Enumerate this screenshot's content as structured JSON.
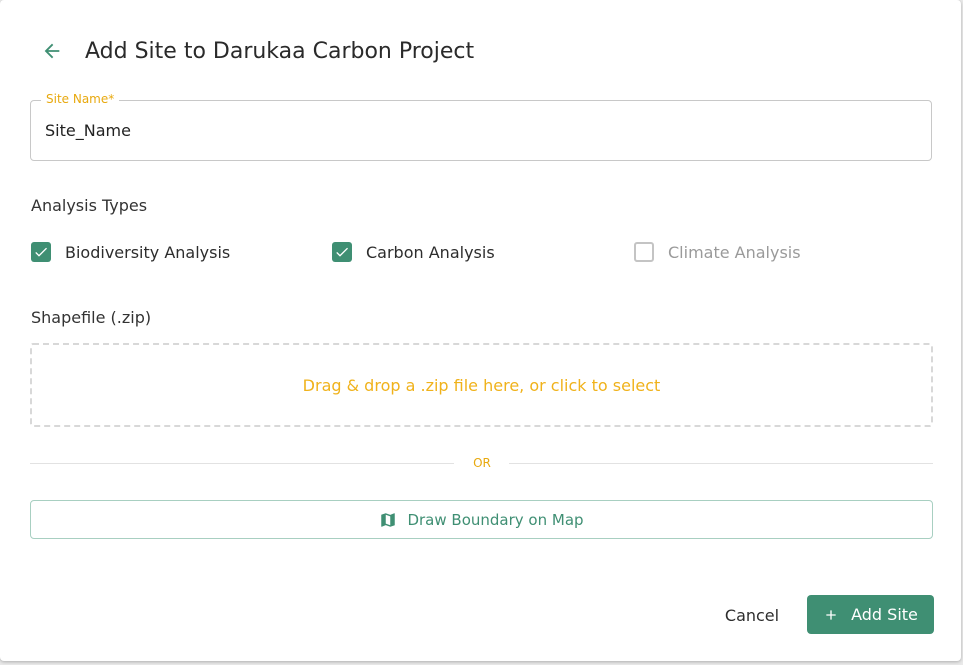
{
  "colors": {
    "accent_green": "#3f8f73",
    "label_amber": "#e8a90f",
    "dropzone_text": "#f0b21b"
  },
  "header": {
    "back_icon": "arrow-left-icon",
    "title": "Add Site to Darukaa Carbon Project"
  },
  "site_name": {
    "label": "Site Name",
    "required_mark": "*",
    "value": "Site_Name"
  },
  "analysis": {
    "heading": "Analysis Types",
    "options": [
      {
        "label": "Biodiversity Analysis",
        "checked": true,
        "disabled": false
      },
      {
        "label": "Carbon Analysis",
        "checked": true,
        "disabled": false
      },
      {
        "label": "Climate Analysis",
        "checked": false,
        "disabled": true
      }
    ]
  },
  "shapefile": {
    "heading": "Shapefile (.zip)",
    "dropzone_text": "Drag & drop a .zip file here, or click to select"
  },
  "divider": {
    "text": "OR"
  },
  "draw_boundary": {
    "icon": "map-icon",
    "label": "Draw Boundary on Map"
  },
  "actions": {
    "cancel_label": "Cancel",
    "add_icon": "plus-icon",
    "add_label": "Add Site"
  }
}
